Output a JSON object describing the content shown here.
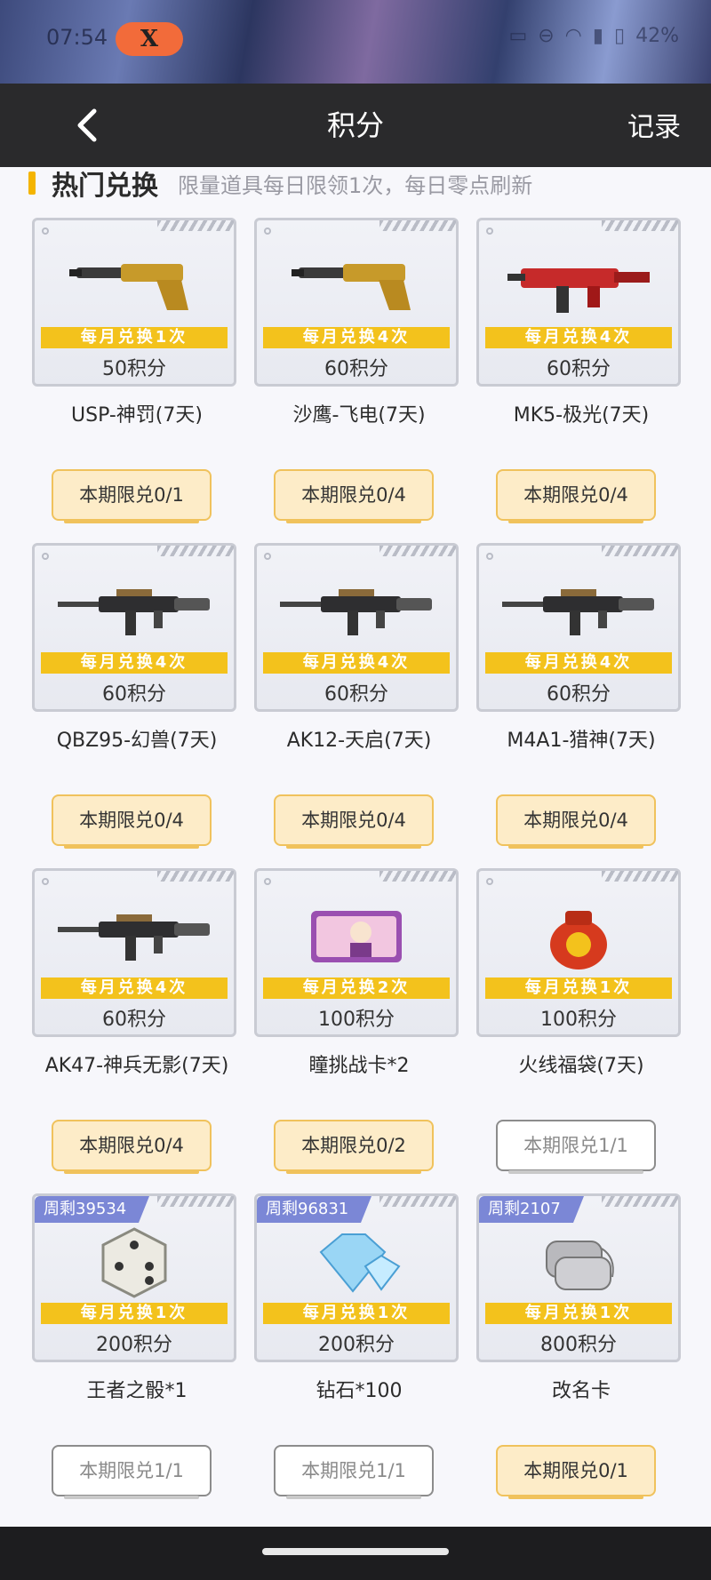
{
  "status_bar": {
    "time": "07:54",
    "app_badge": "X",
    "icons": [
      "nfc-icon",
      "dnd-icon",
      "wifi-icon",
      "signal-icon",
      "hd-icon",
      "signal-icon",
      "battery-icon"
    ],
    "battery": "42%"
  },
  "header": {
    "back_icon": "chevron-left-icon",
    "title": "积分",
    "record": "记录"
  },
  "section": {
    "title": "热门兑换",
    "subtitle": "限量道具每日限领1次，每日零点刷新"
  },
  "colors": {
    "frequency_band": "#f3c21c",
    "button_bg": "#fdecc8",
    "stock_tag": "#7b87d6"
  },
  "items": [
    {
      "name": "USP-神罚(7天)",
      "frequency": "每月兑换1次",
      "points": "50积分",
      "limit": "本期限兑0/1",
      "exhausted": false,
      "icon": "pistol-icon",
      "stock": ""
    },
    {
      "name": "沙鹰-飞电(7天)",
      "frequency": "每月兑换4次",
      "points": "60积分",
      "limit": "本期限兑0/4",
      "exhausted": false,
      "icon": "pistol-icon",
      "stock": ""
    },
    {
      "name": "MK5-极光(7天)",
      "frequency": "每月兑换4次",
      "points": "60积分",
      "limit": "本期限兑0/4",
      "exhausted": false,
      "icon": "smg-icon",
      "stock": ""
    },
    {
      "name": "QBZ95-幻兽(7天)",
      "frequency": "每月兑换4次",
      "points": "60积分",
      "limit": "本期限兑0/4",
      "exhausted": false,
      "icon": "rifle-icon",
      "stock": ""
    },
    {
      "name": "AK12-天启(7天)",
      "frequency": "每月兑换4次",
      "points": "60积分",
      "limit": "本期限兑0/4",
      "exhausted": false,
      "icon": "rifle-icon",
      "stock": ""
    },
    {
      "name": "M4A1-猎神(7天)",
      "frequency": "每月兑换4次",
      "points": "60积分",
      "limit": "本期限兑0/4",
      "exhausted": false,
      "icon": "rifle-icon",
      "stock": ""
    },
    {
      "name": "AK47-神兵无影(7天)",
      "frequency": "每月兑换4次",
      "points": "60积分",
      "limit": "本期限兑0/4",
      "exhausted": false,
      "icon": "rifle-icon",
      "stock": ""
    },
    {
      "name": "瞳挑战卡*2",
      "frequency": "每月兑换2次",
      "points": "100积分",
      "limit": "本期限兑0/2",
      "exhausted": false,
      "icon": "challenge-card-icon",
      "stock": ""
    },
    {
      "name": "火线福袋(7天)",
      "frequency": "每月兑换1次",
      "points": "100积分",
      "limit": "本期限兑1/1",
      "exhausted": true,
      "icon": "lucky-bag-icon",
      "stock": ""
    },
    {
      "name": "王者之骰*1",
      "frequency": "每月兑换1次",
      "points": "200积分",
      "limit": "本期限兑1/1",
      "exhausted": true,
      "icon": "dice-icon",
      "stock": "周剩39534"
    },
    {
      "name": "钻石*100",
      "frequency": "每月兑换1次",
      "points": "200积分",
      "limit": "本期限兑1/1",
      "exhausted": true,
      "icon": "diamond-icon",
      "stock": "周剩96831"
    },
    {
      "name": "改名卡",
      "frequency": "每月兑换1次",
      "points": "800积分",
      "limit": "本期限兑0/1",
      "exhausted": false,
      "icon": "dog-tag-icon",
      "stock": "周剩2107"
    }
  ]
}
